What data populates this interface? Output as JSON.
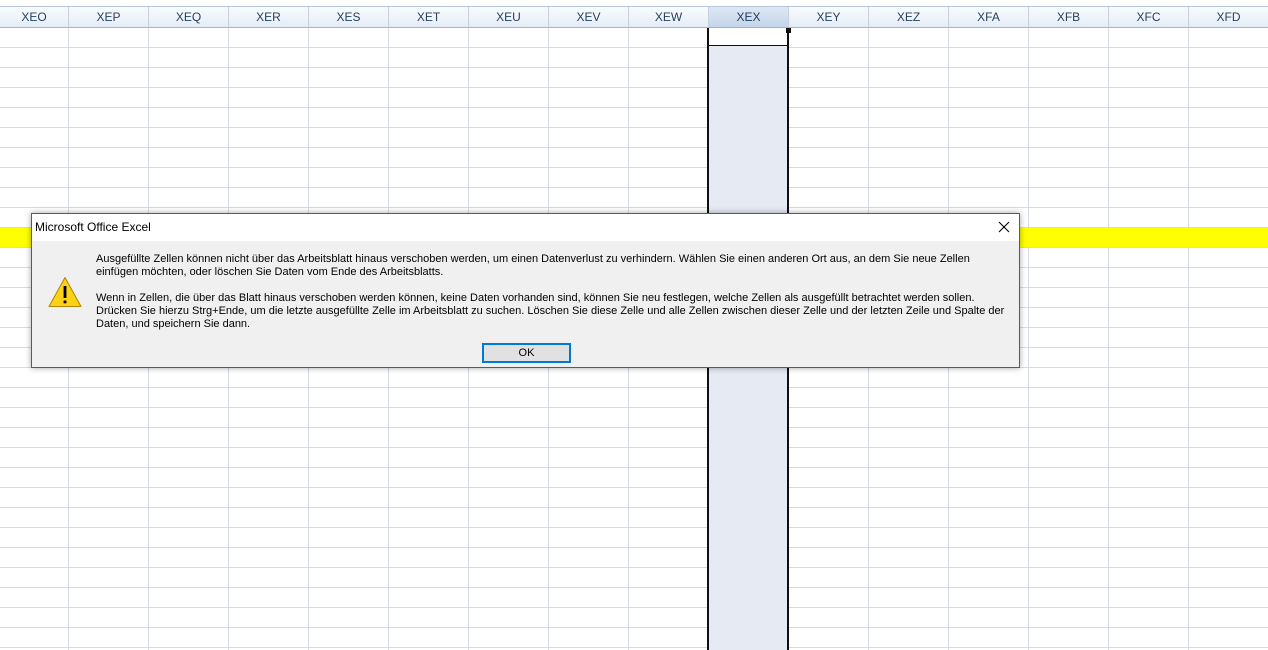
{
  "spreadsheet": {
    "columns": [
      "XEO",
      "XEP",
      "XEQ",
      "XER",
      "XES",
      "XET",
      "XEU",
      "XEV",
      "XEW",
      "XEX",
      "XEY",
      "XEZ",
      "XFA",
      "XFB",
      "XFC",
      "XFD"
    ],
    "selected_column": "XEX",
    "highlight_row_color": "#ffff00",
    "selection_color": "#e6eaf2"
  },
  "dialog": {
    "title": "Microsoft Office Excel",
    "icon": "warning-icon",
    "message1": "Ausgefüllte Zellen können nicht über das Arbeitsblatt hinaus verschoben werden, um einen Datenverlust zu verhindern. Wählen Sie einen anderen Ort aus, an dem Sie neue Zellen einfügen möchten, oder löschen Sie Daten vom Ende des Arbeitsblatts.",
    "message2": "Wenn in Zellen, die über das Blatt hinaus verschoben werden können, keine Daten vorhanden sind, können Sie neu festlegen, welche Zellen als ausgefüllt betrachtet werden sollen. Drücken Sie hierzu Strg+Ende, um die letzte ausgefüllte Zelle im Arbeitsblatt zu suchen. Löschen Sie diese Zelle und alle Zellen zwischen dieser Zelle und der letzten Zeile und Spalte der Daten, und speichern Sie dann.",
    "ok_label": "OK"
  }
}
